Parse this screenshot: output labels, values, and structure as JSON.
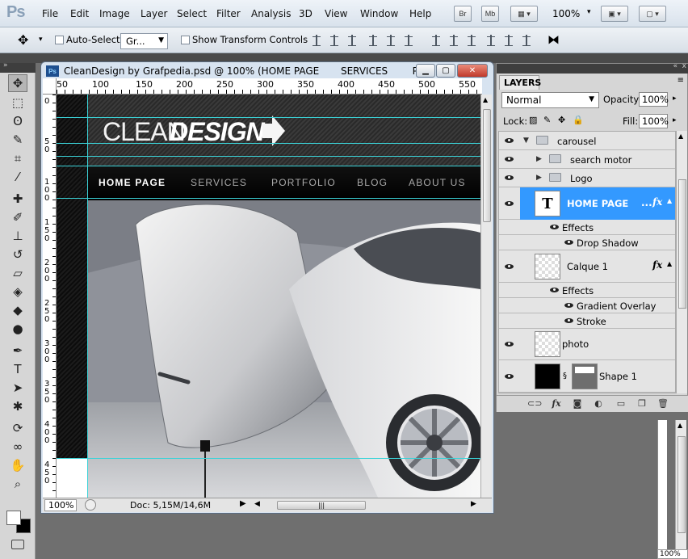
{
  "app": {
    "logo": "Ps"
  },
  "menu": [
    "File",
    "Edit",
    "Image",
    "Layer",
    "Select",
    "Filter",
    "Analysis",
    "3D",
    "View",
    "Window",
    "Help"
  ],
  "appbar": {
    "bridge": "Br",
    "minibridge": "Mb",
    "zoom": "100%"
  },
  "options": {
    "auto_select_label": "Auto-Select:",
    "group_value": "Gr...",
    "show_transform_label": "Show Transform Controls"
  },
  "document": {
    "title": "CleanDesign by Grafpedia.psd @ 100% (HOME PAGE       SERVICES        P...",
    "ruler_top": [
      "50",
      "100",
      "150",
      "200",
      "250",
      "300",
      "350",
      "400",
      "450",
      "500",
      "550"
    ],
    "ruler_left": [
      [
        "0"
      ],
      [
        "5",
        "0"
      ],
      [
        "1",
        "0",
        "0"
      ],
      [
        "1",
        "5",
        "0"
      ],
      [
        "2",
        "0",
        "0"
      ],
      [
        "2",
        "5",
        "0"
      ],
      [
        "3",
        "0",
        "0"
      ],
      [
        "3",
        "5",
        "0"
      ],
      [
        "4",
        "0",
        "0"
      ],
      [
        "4",
        "5",
        "0"
      ]
    ],
    "status_zoom": "100%",
    "status_doc": "Doc: 5,15M/14,6M"
  },
  "site": {
    "logo_clean": "CLEAN",
    "logo_design": "DESIGN",
    "nav": [
      "HOME PAGE",
      "SERVICES",
      "PORTFOLIO",
      "BLOG",
      "ABOUT US"
    ]
  },
  "layers": {
    "tab": "LAYERS",
    "blend_mode": "Normal",
    "opacity_label": "Opacity:",
    "opacity": "100%",
    "lock_label": "Lock:",
    "fill_label": "Fill:",
    "fill": "100%",
    "items": [
      {
        "name": "carousel",
        "kind": "group"
      },
      {
        "name": "search motor",
        "kind": "group"
      },
      {
        "name": "Logo",
        "kind": "group"
      },
      {
        "name": "HOME PAGE",
        "kind": "text",
        "selected": true
      },
      {
        "name": "Effects",
        "kind": "effects"
      },
      {
        "name": "Drop Shadow",
        "kind": "effect"
      },
      {
        "name": "Calque 1",
        "kind": "layer"
      },
      {
        "name": "Effects",
        "kind": "effects"
      },
      {
        "name": "Gradient Overlay",
        "kind": "effect"
      },
      {
        "name": "Stroke",
        "kind": "effect"
      },
      {
        "name": "photo",
        "kind": "smart"
      },
      {
        "name": "Shape 1",
        "kind": "shape"
      }
    ],
    "text_thumb": "T",
    "fx": "fx",
    "fx_more": "..."
  },
  "mini_zoom": "100%",
  "colors": {
    "selection": "#3399ff",
    "guide": "#3bd3d8"
  }
}
